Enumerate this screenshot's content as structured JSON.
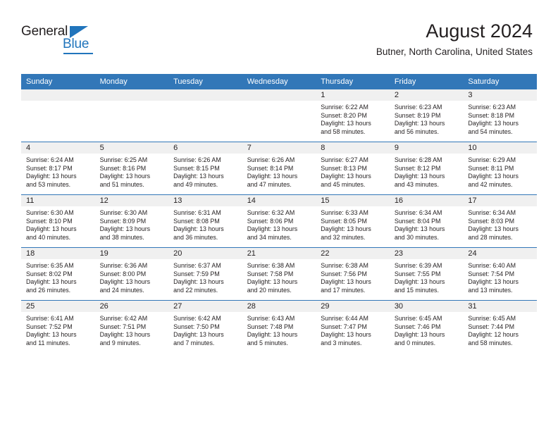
{
  "brand": {
    "name_top": "General",
    "name_bottom": "Blue",
    "accent_color": "#2175bc",
    "triangle_icon": "brand-triangle-icon"
  },
  "header": {
    "title": "August 2024",
    "location": "Butner, North Carolina, United States"
  },
  "colors": {
    "header_blue": "#3277b8",
    "daynum_strip_gray": "#f0f0f0",
    "text": "#231f20",
    "row_divider": "#3277b8"
  },
  "calendar": {
    "weekday_headers": [
      "Sunday",
      "Monday",
      "Tuesday",
      "Wednesday",
      "Thursday",
      "Friday",
      "Saturday"
    ],
    "weeks": [
      [
        {
          "day": "",
          "sunrise": "",
          "sunset": "",
          "daylight_line1": "",
          "daylight_line2": ""
        },
        {
          "day": "",
          "sunrise": "",
          "sunset": "",
          "daylight_line1": "",
          "daylight_line2": ""
        },
        {
          "day": "",
          "sunrise": "",
          "sunset": "",
          "daylight_line1": "",
          "daylight_line2": ""
        },
        {
          "day": "",
          "sunrise": "",
          "sunset": "",
          "daylight_line1": "",
          "daylight_line2": ""
        },
        {
          "day": "1",
          "sunrise": "Sunrise: 6:22 AM",
          "sunset": "Sunset: 8:20 PM",
          "daylight_line1": "Daylight: 13 hours",
          "daylight_line2": "and 58 minutes."
        },
        {
          "day": "2",
          "sunrise": "Sunrise: 6:23 AM",
          "sunset": "Sunset: 8:19 PM",
          "daylight_line1": "Daylight: 13 hours",
          "daylight_line2": "and 56 minutes."
        },
        {
          "day": "3",
          "sunrise": "Sunrise: 6:23 AM",
          "sunset": "Sunset: 8:18 PM",
          "daylight_line1": "Daylight: 13 hours",
          "daylight_line2": "and 54 minutes."
        }
      ],
      [
        {
          "day": "4",
          "sunrise": "Sunrise: 6:24 AM",
          "sunset": "Sunset: 8:17 PM",
          "daylight_line1": "Daylight: 13 hours",
          "daylight_line2": "and 53 minutes."
        },
        {
          "day": "5",
          "sunrise": "Sunrise: 6:25 AM",
          "sunset": "Sunset: 8:16 PM",
          "daylight_line1": "Daylight: 13 hours",
          "daylight_line2": "and 51 minutes."
        },
        {
          "day": "6",
          "sunrise": "Sunrise: 6:26 AM",
          "sunset": "Sunset: 8:15 PM",
          "daylight_line1": "Daylight: 13 hours",
          "daylight_line2": "and 49 minutes."
        },
        {
          "day": "7",
          "sunrise": "Sunrise: 6:26 AM",
          "sunset": "Sunset: 8:14 PM",
          "daylight_line1": "Daylight: 13 hours",
          "daylight_line2": "and 47 minutes."
        },
        {
          "day": "8",
          "sunrise": "Sunrise: 6:27 AM",
          "sunset": "Sunset: 8:13 PM",
          "daylight_line1": "Daylight: 13 hours",
          "daylight_line2": "and 45 minutes."
        },
        {
          "day": "9",
          "sunrise": "Sunrise: 6:28 AM",
          "sunset": "Sunset: 8:12 PM",
          "daylight_line1": "Daylight: 13 hours",
          "daylight_line2": "and 43 minutes."
        },
        {
          "day": "10",
          "sunrise": "Sunrise: 6:29 AM",
          "sunset": "Sunset: 8:11 PM",
          "daylight_line1": "Daylight: 13 hours",
          "daylight_line2": "and 42 minutes."
        }
      ],
      [
        {
          "day": "11",
          "sunrise": "Sunrise: 6:30 AM",
          "sunset": "Sunset: 8:10 PM",
          "daylight_line1": "Daylight: 13 hours",
          "daylight_line2": "and 40 minutes."
        },
        {
          "day": "12",
          "sunrise": "Sunrise: 6:30 AM",
          "sunset": "Sunset: 8:09 PM",
          "daylight_line1": "Daylight: 13 hours",
          "daylight_line2": "and 38 minutes."
        },
        {
          "day": "13",
          "sunrise": "Sunrise: 6:31 AM",
          "sunset": "Sunset: 8:08 PM",
          "daylight_line1": "Daylight: 13 hours",
          "daylight_line2": "and 36 minutes."
        },
        {
          "day": "14",
          "sunrise": "Sunrise: 6:32 AM",
          "sunset": "Sunset: 8:06 PM",
          "daylight_line1": "Daylight: 13 hours",
          "daylight_line2": "and 34 minutes."
        },
        {
          "day": "15",
          "sunrise": "Sunrise: 6:33 AM",
          "sunset": "Sunset: 8:05 PM",
          "daylight_line1": "Daylight: 13 hours",
          "daylight_line2": "and 32 minutes."
        },
        {
          "day": "16",
          "sunrise": "Sunrise: 6:34 AM",
          "sunset": "Sunset: 8:04 PM",
          "daylight_line1": "Daylight: 13 hours",
          "daylight_line2": "and 30 minutes."
        },
        {
          "day": "17",
          "sunrise": "Sunrise: 6:34 AM",
          "sunset": "Sunset: 8:03 PM",
          "daylight_line1": "Daylight: 13 hours",
          "daylight_line2": "and 28 minutes."
        }
      ],
      [
        {
          "day": "18",
          "sunrise": "Sunrise: 6:35 AM",
          "sunset": "Sunset: 8:02 PM",
          "daylight_line1": "Daylight: 13 hours",
          "daylight_line2": "and 26 minutes."
        },
        {
          "day": "19",
          "sunrise": "Sunrise: 6:36 AM",
          "sunset": "Sunset: 8:00 PM",
          "daylight_line1": "Daylight: 13 hours",
          "daylight_line2": "and 24 minutes."
        },
        {
          "day": "20",
          "sunrise": "Sunrise: 6:37 AM",
          "sunset": "Sunset: 7:59 PM",
          "daylight_line1": "Daylight: 13 hours",
          "daylight_line2": "and 22 minutes."
        },
        {
          "day": "21",
          "sunrise": "Sunrise: 6:38 AM",
          "sunset": "Sunset: 7:58 PM",
          "daylight_line1": "Daylight: 13 hours",
          "daylight_line2": "and 20 minutes."
        },
        {
          "day": "22",
          "sunrise": "Sunrise: 6:38 AM",
          "sunset": "Sunset: 7:56 PM",
          "daylight_line1": "Daylight: 13 hours",
          "daylight_line2": "and 17 minutes."
        },
        {
          "day": "23",
          "sunrise": "Sunrise: 6:39 AM",
          "sunset": "Sunset: 7:55 PM",
          "daylight_line1": "Daylight: 13 hours",
          "daylight_line2": "and 15 minutes."
        },
        {
          "day": "24",
          "sunrise": "Sunrise: 6:40 AM",
          "sunset": "Sunset: 7:54 PM",
          "daylight_line1": "Daylight: 13 hours",
          "daylight_line2": "and 13 minutes."
        }
      ],
      [
        {
          "day": "25",
          "sunrise": "Sunrise: 6:41 AM",
          "sunset": "Sunset: 7:52 PM",
          "daylight_line1": "Daylight: 13 hours",
          "daylight_line2": "and 11 minutes."
        },
        {
          "day": "26",
          "sunrise": "Sunrise: 6:42 AM",
          "sunset": "Sunset: 7:51 PM",
          "daylight_line1": "Daylight: 13 hours",
          "daylight_line2": "and 9 minutes."
        },
        {
          "day": "27",
          "sunrise": "Sunrise: 6:42 AM",
          "sunset": "Sunset: 7:50 PM",
          "daylight_line1": "Daylight: 13 hours",
          "daylight_line2": "and 7 minutes."
        },
        {
          "day": "28",
          "sunrise": "Sunrise: 6:43 AM",
          "sunset": "Sunset: 7:48 PM",
          "daylight_line1": "Daylight: 13 hours",
          "daylight_line2": "and 5 minutes."
        },
        {
          "day": "29",
          "sunrise": "Sunrise: 6:44 AM",
          "sunset": "Sunset: 7:47 PM",
          "daylight_line1": "Daylight: 13 hours",
          "daylight_line2": "and 3 minutes."
        },
        {
          "day": "30",
          "sunrise": "Sunrise: 6:45 AM",
          "sunset": "Sunset: 7:46 PM",
          "daylight_line1": "Daylight: 13 hours",
          "daylight_line2": "and 0 minutes."
        },
        {
          "day": "31",
          "sunrise": "Sunrise: 6:45 AM",
          "sunset": "Sunset: 7:44 PM",
          "daylight_line1": "Daylight: 12 hours",
          "daylight_line2": "and 58 minutes."
        }
      ]
    ]
  }
}
